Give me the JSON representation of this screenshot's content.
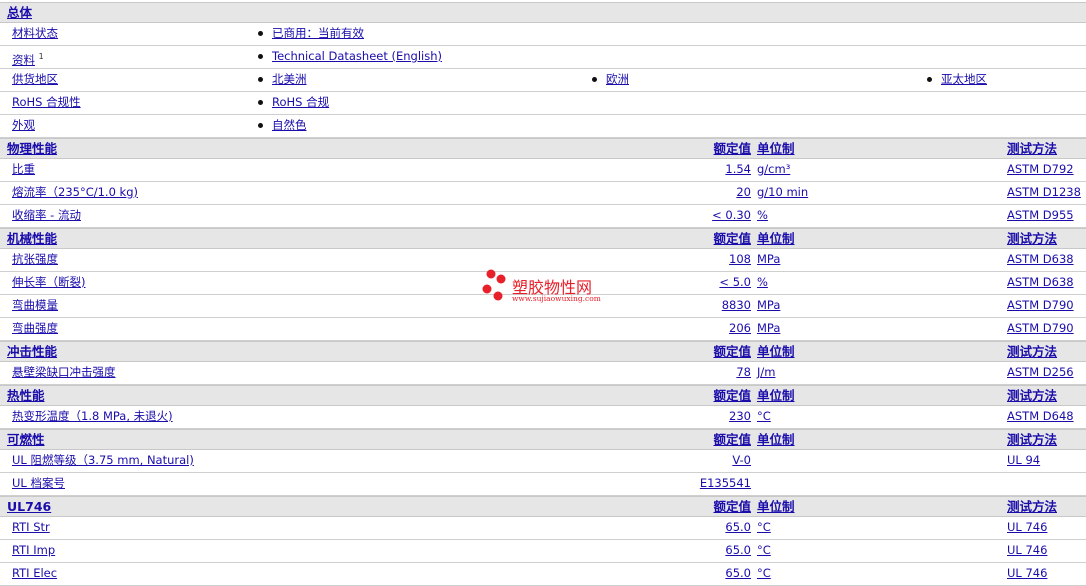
{
  "sections": [
    {
      "title": "总体",
      "info": true,
      "rows": [
        {
          "label": "材料状态",
          "items": [
            "已商用：当前有效"
          ]
        },
        {
          "label": "资料",
          "sup": "1",
          "items": [
            "Technical Datasheet (English)"
          ],
          "link": true
        },
        {
          "label": "供货地区",
          "items": [
            "北美洲",
            "欧洲",
            "亚太地区"
          ]
        },
        {
          "label": "RoHS 合规性",
          "items": [
            "RoHS 合规"
          ]
        },
        {
          "label": "外观",
          "items": [
            "自然色"
          ]
        }
      ]
    },
    {
      "title": "物理性能",
      "h_val": "额定值",
      "h_unit": "单位制",
      "h_test": "测试方法",
      "rows": [
        {
          "label": "比重",
          "val": "1.54",
          "unit": "g/cm³",
          "test": "ASTM D792"
        },
        {
          "label": "熔流率（235°C/1.0 kg)",
          "val": "20",
          "unit": "g/10 min",
          "test": "ASTM D1238"
        },
        {
          "label": "收缩率 - 流动",
          "val": "< 0.30",
          "unit": "%",
          "test": "ASTM D955"
        }
      ]
    },
    {
      "title": "机械性能",
      "h_val": "额定值",
      "h_unit": "单位制",
      "h_test": "测试方法",
      "rows": [
        {
          "label": "抗张强度",
          "val": "108",
          "unit": "MPa",
          "test": "ASTM D638"
        },
        {
          "label": "伸长率（断裂)",
          "val": "< 5.0",
          "unit": "%",
          "test": "ASTM D638"
        },
        {
          "label": "弯曲模量",
          "val": "8830",
          "unit": "MPa",
          "test": "ASTM D790"
        },
        {
          "label": "弯曲强度",
          "val": "206",
          "unit": "MPa",
          "test": "ASTM D790"
        }
      ]
    },
    {
      "title": "冲击性能",
      "h_val": "额定值",
      "h_unit": "单位制",
      "h_test": "测试方法",
      "rows": [
        {
          "label": "悬壁梁缺口冲击强度",
          "val": "78",
          "unit": "J/m",
          "test": "ASTM D256"
        }
      ]
    },
    {
      "title": "热性能",
      "h_val": "额定值",
      "h_unit": "单位制",
      "h_test": "测试方法",
      "rows": [
        {
          "label": "热变形温度（1.8 MPa, 未退火)",
          "val": "230",
          "unit": "°C",
          "test": "ASTM D648"
        }
      ]
    },
    {
      "title": "可燃性",
      "h_val": "额定值",
      "h_unit": "单位制",
      "h_test": "测试方法",
      "rows": [
        {
          "label": "UL 阻燃等级（3.75 mm, Natural)",
          "val": "V-0",
          "unit": "",
          "test": "UL 94"
        },
        {
          "label": "UL 档案号",
          "val": "E135541",
          "unit": "",
          "test": ""
        }
      ]
    },
    {
      "title": "UL746",
      "h_val": "额定值",
      "h_unit": "单位制",
      "h_test": "测试方法",
      "rows": [
        {
          "label": "RTI Str",
          "val": "65.0",
          "unit": "°C",
          "test": "UL 746"
        },
        {
          "label": "RTI Imp",
          "val": "65.0",
          "unit": "°C",
          "test": "UL 746"
        },
        {
          "label": "RTI Elec",
          "val": "65.0",
          "unit": "°C",
          "test": "UL 746"
        }
      ]
    }
  ],
  "watermark": {
    "name": "塑胶物性网",
    "url": "www.sujiaowuxing.com",
    "color": "#e8202a"
  }
}
